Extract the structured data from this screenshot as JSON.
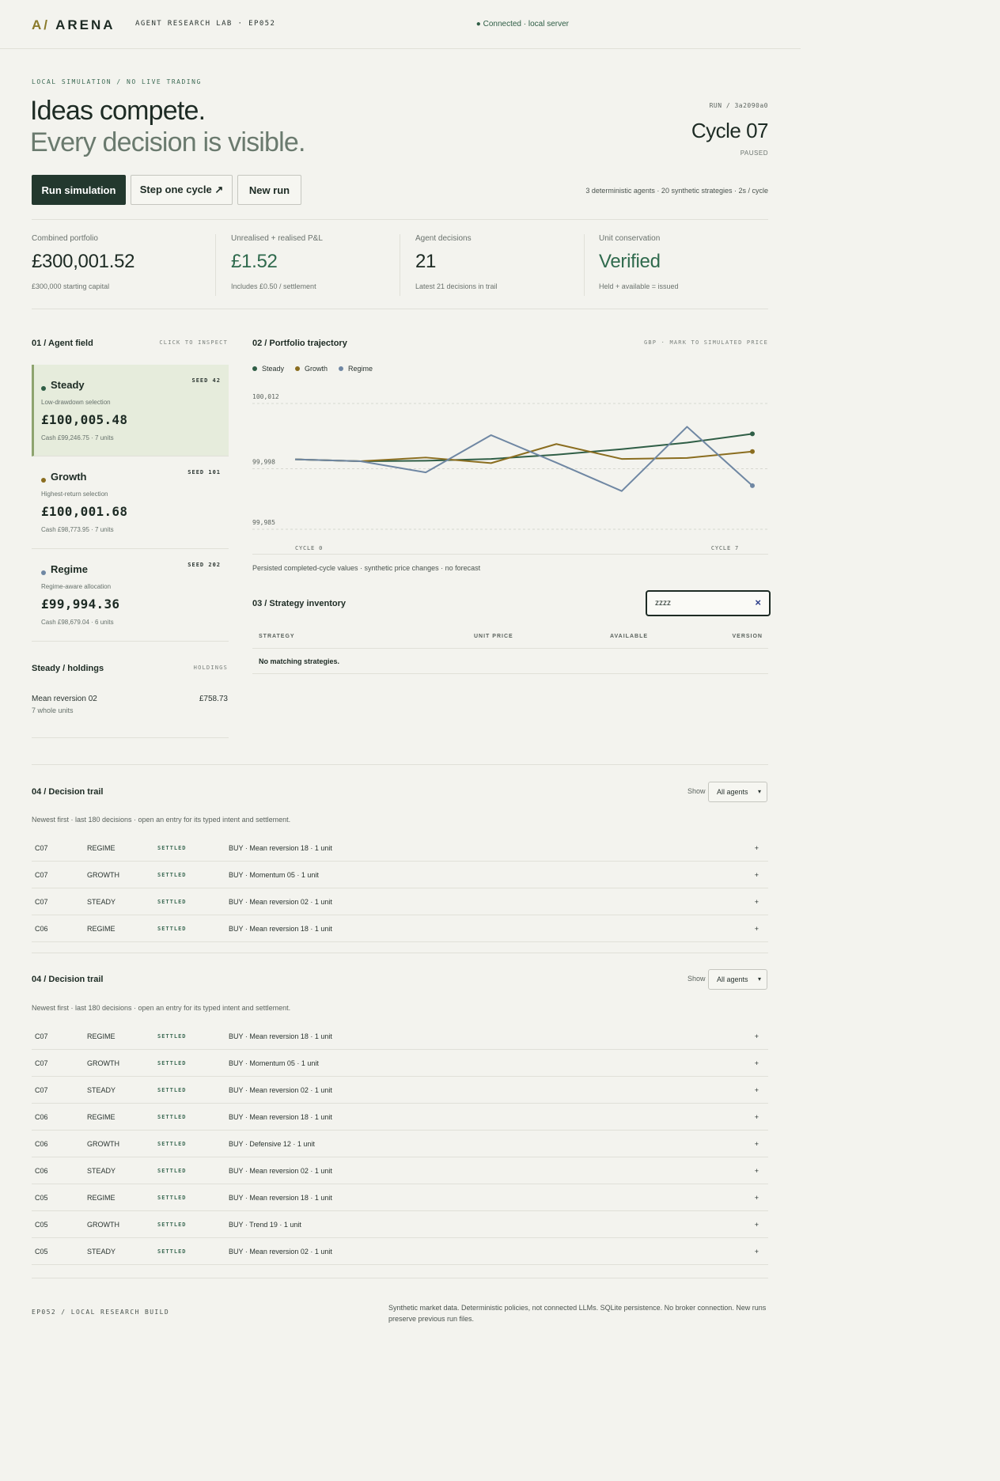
{
  "header": {
    "logo_mark": "A/",
    "logo_text": "ARENA",
    "lab": "AGENT RESEARCH LAB · EP052",
    "connection": "● Connected · local server"
  },
  "hero": {
    "eyebrow": "LOCAL SIMULATION / NO LIVE TRADING",
    "title_line1": "Ideas compete.",
    "title_line2": "Every decision is visible.",
    "run_id": "RUN / 3a2090a0",
    "cycle": "Cycle 07",
    "status": "PAUSED"
  },
  "actions": {
    "run_label": "Run simulation",
    "step_label": "Step one cycle ↗",
    "new_label": "New run",
    "info": "3 deterministic agents · 20 synthetic strategies · 2s / cycle"
  },
  "stats": [
    {
      "label": "Combined portfolio",
      "value": "£300,001.52",
      "sub": "£300,000 starting capital"
    },
    {
      "label": "Unrealised + realised P&L",
      "value": "£1.52",
      "sub": "Includes £0.50 / settlement"
    },
    {
      "label": "Agent decisions",
      "value": "21",
      "sub": "Latest 21 decisions in trail"
    },
    {
      "label": "Unit conservation",
      "value": "Verified",
      "sub": "Held + available = issued"
    }
  ],
  "agent_field": {
    "title": "01 / Agent field",
    "hint": "CLICK TO INSPECT",
    "agents": [
      {
        "name": "Steady",
        "seed": "SEED 42",
        "desc": "Low-drawdown selection",
        "amount": "£100,005.48",
        "cash": "Cash £99,246.75 · 7 units",
        "color": "#2f5e46"
      },
      {
        "name": "Growth",
        "seed": "SEED 101",
        "desc": "Highest-return selection",
        "amount": "£100,001.68",
        "cash": "Cash £98,773.95 · 7 units",
        "color": "#8a6d1f"
      },
      {
        "name": "Regime",
        "seed": "SEED 202",
        "desc": "Regime-aware allocation",
        "amount": "£99,994.36",
        "cash": "Cash £98,679.04 · 6 units",
        "color": "#6f87a3"
      }
    ]
  },
  "holdings": {
    "title": "Steady / holdings",
    "hint": "HOLDINGS",
    "items": [
      {
        "name": "Mean reversion 02",
        "units": "7 whole units",
        "value": "£758.73"
      }
    ]
  },
  "trajectory": {
    "title": "02 / Portfolio trajectory",
    "hint": "GBP · MARK TO SIMULATED PRICE",
    "note": "Persisted completed-cycle values · synthetic price changes · no forecast"
  },
  "chart_data": {
    "type": "line",
    "x": [
      0,
      1,
      2,
      3,
      4,
      5,
      6,
      7
    ],
    "x_tick_labels": [
      "CYCLE 0",
      "CYCLE 7"
    ],
    "y_ticks": [
      99985,
      99998,
      100012
    ],
    "y_tick_labels": [
      "99,985",
      "99,998",
      "100,012"
    ],
    "ylim": [
      99985,
      100012
    ],
    "grid": true,
    "legend": "top-left",
    "series": [
      {
        "name": "Steady",
        "color": "#2f5e46",
        "values": [
          100000,
          99999.6,
          99999.7,
          100000.1,
          100001.0,
          100002.2,
          100003.6,
          100005.48
        ]
      },
      {
        "name": "Growth",
        "color": "#8a6d1f",
        "values": [
          100000,
          99999.6,
          100000.4,
          99999.2,
          100003.3,
          100000.1,
          100000.3,
          100001.68
        ]
      },
      {
        "name": "Regime",
        "color": "#6f87a3",
        "values": [
          100000,
          99999.6,
          99997.2,
          100005.2,
          99999.3,
          99993.2,
          100007.0,
          99994.36
        ]
      }
    ]
  },
  "inventory": {
    "title": "03 / Strategy inventory",
    "search_value": "zzzz",
    "clear_icon": "×",
    "columns": [
      "STRATEGY",
      "UNIT PRICE",
      "AVAILABLE",
      "VERSION"
    ],
    "empty": "No matching strategies."
  },
  "trail_a": {
    "title": "04 / Decision trail",
    "show_label": "Show",
    "filter": "All agents",
    "note": "Newest first · last 180 decisions · open an entry for its typed intent and settlement.",
    "rows": [
      {
        "cycle": "C07",
        "agent": "REGIME",
        "status": "SETTLED",
        "action": "BUY · Mean reversion 18 · 1 unit",
        "expand": "+"
      },
      {
        "cycle": "C07",
        "agent": "GROWTH",
        "status": "SETTLED",
        "action": "BUY · Momentum 05 · 1 unit",
        "expand": "+"
      },
      {
        "cycle": "C07",
        "agent": "STEADY",
        "status": "SETTLED",
        "action": "BUY · Mean reversion 02 · 1 unit",
        "expand": "+"
      },
      {
        "cycle": "C06",
        "agent": "REGIME",
        "status": "SETTLED",
        "action": "BUY · Mean reversion 18 · 1 unit",
        "expand": "+"
      }
    ]
  },
  "trail_b": {
    "title": "04 / Decision trail",
    "show_label": "Show",
    "filter": "All agents",
    "note": "Newest first · last 180 decisions · open an entry for its typed intent and settlement.",
    "rows": [
      {
        "cycle": "C07",
        "agent": "REGIME",
        "status": "SETTLED",
        "action": "BUY · Mean reversion 18 · 1 unit",
        "expand": "+"
      },
      {
        "cycle": "C07",
        "agent": "GROWTH",
        "status": "SETTLED",
        "action": "BUY · Momentum 05 · 1 unit",
        "expand": "+"
      },
      {
        "cycle": "C07",
        "agent": "STEADY",
        "status": "SETTLED",
        "action": "BUY · Mean reversion 02 · 1 unit",
        "expand": "+"
      },
      {
        "cycle": "C06",
        "agent": "REGIME",
        "status": "SETTLED",
        "action": "BUY · Mean reversion 18 · 1 unit",
        "expand": "+"
      },
      {
        "cycle": "C06",
        "agent": "GROWTH",
        "status": "SETTLED",
        "action": "BUY · Defensive 12 · 1 unit",
        "expand": "+"
      },
      {
        "cycle": "C06",
        "agent": "STEADY",
        "status": "SETTLED",
        "action": "BUY · Mean reversion 02 · 1 unit",
        "expand": "+"
      },
      {
        "cycle": "C05",
        "agent": "REGIME",
        "status": "SETTLED",
        "action": "BUY · Mean reversion 18 · 1 unit",
        "expand": "+"
      },
      {
        "cycle": "C05",
        "agent": "GROWTH",
        "status": "SETTLED",
        "action": "BUY · Trend 19 · 1 unit",
        "expand": "+"
      },
      {
        "cycle": "C05",
        "agent": "STEADY",
        "status": "SETTLED",
        "action": "BUY · Mean reversion 02 · 1 unit",
        "expand": "+"
      }
    ]
  },
  "footer": {
    "left": "EP052 / LOCAL RESEARCH BUILD",
    "right": "Synthetic market data. Deterministic policies, not connected LLMs. SQLite persistence. No broker connection. New runs preserve previous run files."
  }
}
